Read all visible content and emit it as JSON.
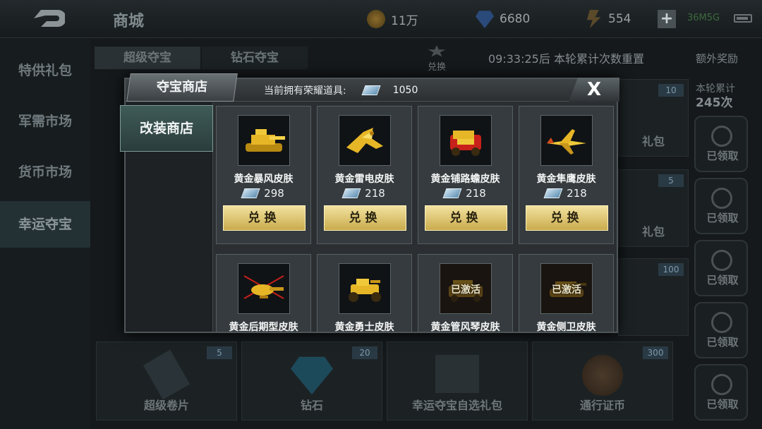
{
  "header": {
    "title": "商城",
    "coins": "11万",
    "diamonds": "6680",
    "energy": "554",
    "network": "36M5G"
  },
  "left_nav": {
    "items": [
      {
        "label": "特供礼包"
      },
      {
        "label": "军需市场"
      },
      {
        "label": "货币市场"
      },
      {
        "label": "幸运夺宝"
      }
    ]
  },
  "background": {
    "tab_super": "超级夺宝",
    "tab_diamond": "钻石夺宝",
    "exchange_label": "兑换",
    "timer": "09:33:25后 本轮累计次数重置",
    "extra_reward": "额外奖励",
    "round_total_label": "本轮累计",
    "round_total_value": "245次",
    "claimed_label": "已领取",
    "card_badges": [
      "10",
      "5",
      "100"
    ],
    "gift_label": "礼包",
    "bottom_cards": [
      {
        "label": "超级卷片",
        "badge": "5"
      },
      {
        "label": "钻石",
        "badge": "20"
      },
      {
        "label": "幸运夺宝自选礼包",
        "badge": ""
      },
      {
        "label": "通行证币",
        "badge": "300"
      }
    ]
  },
  "modal": {
    "title": "夺宝商店",
    "honor_label": "当前拥有荣耀道具:",
    "honor_amount": "1050",
    "close_label": "X",
    "side_tab": "改装商店",
    "items": [
      {
        "name": "黄金暴风皮肤",
        "price": "298",
        "button": "兑换",
        "activated": false,
        "icon": "gold-tank-icon"
      },
      {
        "name": "黄金雷电皮肤",
        "price": "218",
        "button": "兑换",
        "activated": false,
        "icon": "gold-jet-icon"
      },
      {
        "name": "黄金铺路蟾皮肤",
        "price": "218",
        "button": "兑换",
        "activated": false,
        "icon": "gold-armored-car-icon"
      },
      {
        "name": "黄金隼鹰皮肤",
        "price": "218",
        "button": "兑换",
        "activated": false,
        "icon": "gold-fighter-icon"
      },
      {
        "name": "黄金后期型皮肤",
        "price": "",
        "button": "",
        "activated": false,
        "icon": "gold-helicopter-icon"
      },
      {
        "name": "黄金勇士皮肤",
        "price": "",
        "button": "",
        "activated": false,
        "icon": "gold-buggy-icon"
      },
      {
        "name": "黄金管风琴皮肤",
        "price": "",
        "button": "",
        "activated": true,
        "activated_label": "已激活",
        "icon": "gold-rocket-truck-icon"
      },
      {
        "name": "黄金侧卫皮肤",
        "price": "",
        "button": "",
        "activated": true,
        "activated_label": "已激活",
        "icon": "gold-guard-tank-icon"
      }
    ]
  }
}
